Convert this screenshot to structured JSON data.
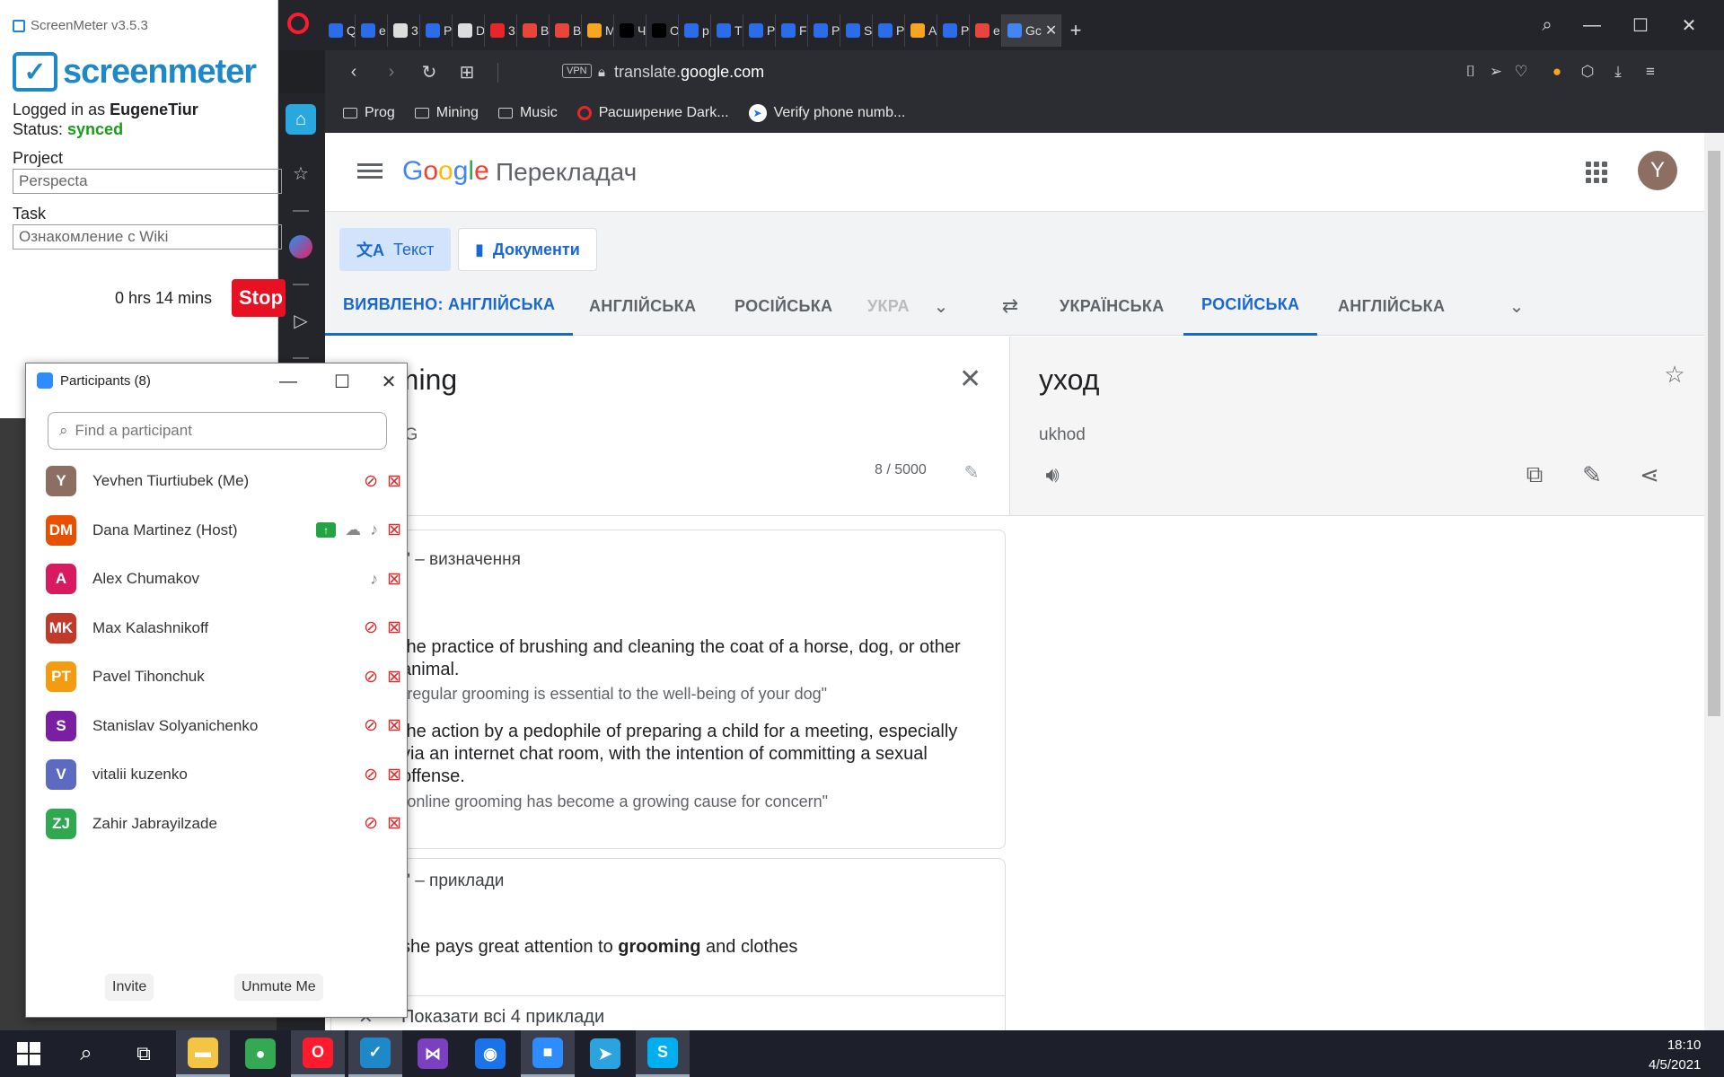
{
  "browser": {
    "tabs": [
      {
        "label": "Q",
        "color": "#2b6de8"
      },
      {
        "label": "e",
        "color": "#2b6de8"
      },
      {
        "label": "3",
        "color": "#ddd"
      },
      {
        "label": "P",
        "color": "#2b6de8"
      },
      {
        "label": "D",
        "color": "#ddd"
      },
      {
        "label": "3",
        "color": "#e8262a"
      },
      {
        "label": "B",
        "color": "#e8453c"
      },
      {
        "label": "B",
        "color": "#e8453c"
      },
      {
        "label": "M",
        "color": "#f6a623"
      },
      {
        "label": "Ч",
        "color": "#000"
      },
      {
        "label": "O",
        "color": "#000"
      },
      {
        "label": "p",
        "color": "#2b6de8"
      },
      {
        "label": "T",
        "color": "#2b6de8"
      },
      {
        "label": "P",
        "color": "#2b6de8"
      },
      {
        "label": "F",
        "color": "#2b6de8"
      },
      {
        "label": "P",
        "color": "#2b6de8"
      },
      {
        "label": "S",
        "color": "#2b6de8"
      },
      {
        "label": "P",
        "color": "#2b6de8"
      },
      {
        "label": "A",
        "color": "#f6a623"
      },
      {
        "label": "P",
        "color": "#2b6de8"
      },
      {
        "label": "e",
        "color": "#e8453c"
      }
    ],
    "active_tab": {
      "label": "Gc",
      "color": "#4285f4"
    },
    "url_host": "translate.",
    "url_domain": "google.com",
    "vpn_label": "VPN",
    "bookmarks": [
      {
        "label": "Prog",
        "icon": "folder-icon"
      },
      {
        "label": "Mining",
        "icon": "folder-icon"
      },
      {
        "label": "Music",
        "icon": "folder-icon"
      },
      {
        "label": "Расширение Dark...",
        "icon": "opera-icon"
      },
      {
        "label": "Verify phone numb...",
        "icon": "arrow-icon"
      }
    ]
  },
  "translate": {
    "app_name": "Перекладач",
    "avatar_letter": "Y",
    "mode_text": "Текст",
    "mode_docs": "Документи",
    "src_langs": [
      "ВИЯВЛЕНО: АНГЛІЙСЬКА",
      "АНГЛІЙСЬКА",
      "РОСІЙСЬКА",
      "УКРА"
    ],
    "tgt_langs": [
      "УКРАЇНСЬКА",
      "РОСІЙСЬКА",
      "АНГЛІЙСЬКА"
    ],
    "source_text": "oming",
    "source_translit": "niNG",
    "char_count": "8 / 5000",
    "target_text": "уход",
    "target_translit": "ukhod",
    "definitions_title": "ming\" – визначення",
    "pos": "ик",
    "def1": "the practice of brushing and cleaning the coat of a horse, dog, or other animal.",
    "ex1": "\"regular grooming is essential to the well-being of your dog\"",
    "def2": "the action by a pedophile of preparing a child for a meeting, especially via an internet chat room, with the intention of committing a sexual offense.",
    "ex2": "\"online grooming has become a growing cause for concern\"",
    "examples_title": "ming\" – приклади",
    "example_pre": "she pays great attention to ",
    "example_bold": "grooming",
    "example_post": " and clothes",
    "show_all": "Показати всі 4 приклади"
  },
  "screenmeter": {
    "title": "ScreenMeter v3.5.3",
    "logo_text": "screenmeter",
    "logged_prefix": "Logged in as ",
    "user": "EugeneTiur",
    "status_prefix": "Status: ",
    "status": "synced",
    "status_color": "#1a9b1a",
    "project_label": "Project",
    "project_value": "Perspecta",
    "task_label": "Task",
    "task_value": "Ознакомление с Wiki",
    "timer": "0 hrs 14 mins",
    "stop_label": "Stop"
  },
  "zoom": {
    "title": "Participants (8)",
    "search_placeholder": "Find a participant",
    "participants": [
      {
        "initials": "Y",
        "name": "Yevhen Tiurtiubek (Me)",
        "color": "#8d6e63",
        "mic": "muted",
        "share": false,
        "cloud": false
      },
      {
        "initials": "DM",
        "name": "Dana Martinez (Host)",
        "color": "#e65100",
        "mic": "on",
        "share": true,
        "cloud": true
      },
      {
        "initials": "A",
        "name": "Alex Chumakov",
        "color": "#d81b60",
        "mic": "on",
        "share": false,
        "cloud": false
      },
      {
        "initials": "MK",
        "name": "Max Kalashnikoff",
        "color": "#c0392b",
        "mic": "muted",
        "share": false,
        "cloud": false
      },
      {
        "initials": "PT",
        "name": "Pavel Tihonchuk",
        "color": "#f39c12",
        "mic": "muted",
        "share": false,
        "cloud": false
      },
      {
        "initials": "S",
        "name": "Stanislav Solyanichenko",
        "color": "#7b1fa2",
        "mic": "muted",
        "share": false,
        "cloud": false
      },
      {
        "initials": "V",
        "name": "vitalii kuzenko",
        "color": "#5c6bc0",
        "mic": "muted",
        "share": false,
        "cloud": false
      },
      {
        "initials": "ZJ",
        "name": "Zahir Jabrayilzade",
        "color": "#2fa84f",
        "mic": "muted",
        "share": false,
        "cloud": false
      }
    ],
    "invite_label": "Invite",
    "unmute_label": "Unmute Me"
  },
  "taskbar": {
    "time": "18:10",
    "date": "4/5/2021",
    "apps": [
      {
        "name": "file-explorer",
        "color": "#f4c542",
        "glyph": "▬"
      },
      {
        "name": "chrome",
        "color": "#34a853",
        "glyph": "●"
      },
      {
        "name": "opera",
        "color": "#ff1b2d",
        "glyph": "O"
      },
      {
        "name": "screenmeter",
        "color": "#1e88c9",
        "glyph": "✓"
      },
      {
        "name": "visual-studio",
        "color": "#7b3fbf",
        "glyph": "⋈"
      },
      {
        "name": "maps",
        "color": "#1a73e8",
        "glyph": "◉"
      },
      {
        "name": "zoom",
        "color": "#2d8cff",
        "glyph": "■"
      },
      {
        "name": "telegram",
        "color": "#2aa3df",
        "glyph": "➤"
      },
      {
        "name": "skype",
        "color": "#00aff0",
        "glyph": "S"
      }
    ]
  }
}
